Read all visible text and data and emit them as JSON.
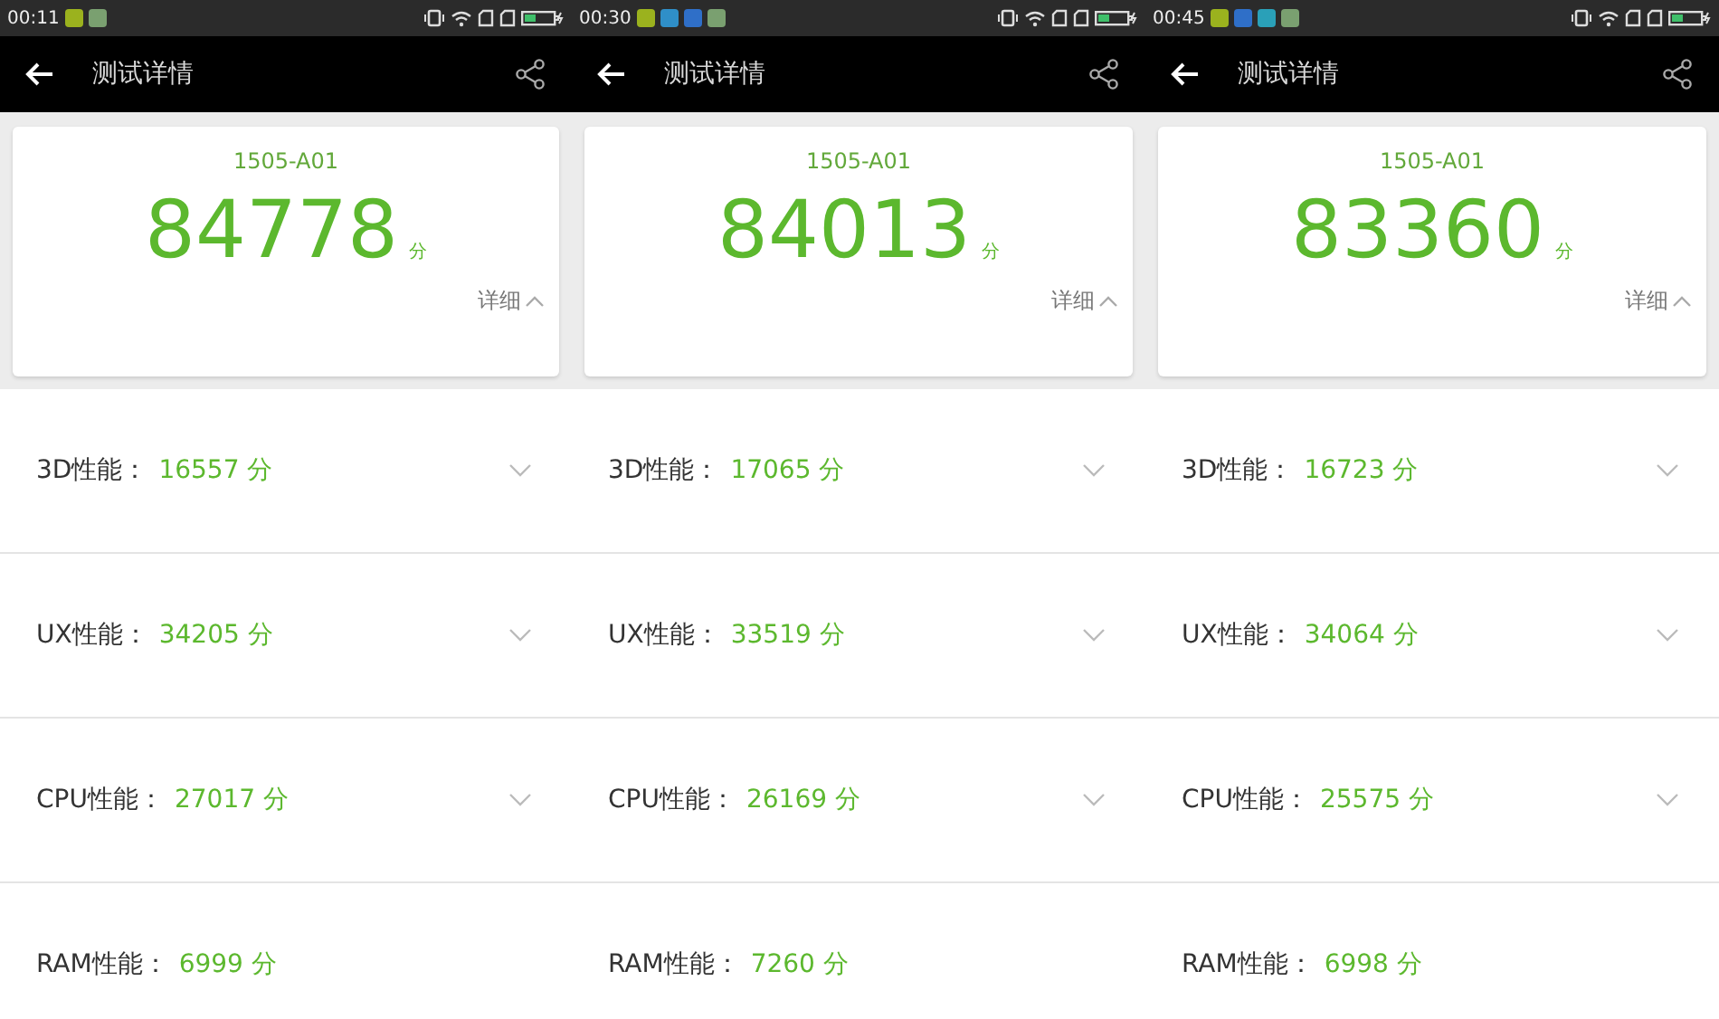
{
  "panels": [
    {
      "status_bar": {
        "time": "00:11",
        "notifications": [
          {
            "color": "#9bb21e"
          },
          {
            "color": "#7aa070"
          }
        ]
      },
      "header": {
        "title": "测试详情"
      },
      "card": {
        "device": "1505-A01",
        "score": "84778",
        "unit": "分",
        "details": "详细"
      },
      "rows": [
        {
          "label": "3D性能：",
          "value": "16557 分",
          "expandable": true
        },
        {
          "label": "UX性能：",
          "value": "34205 分",
          "expandable": true
        },
        {
          "label": "CPU性能：",
          "value": "27017 分",
          "expandable": true
        },
        {
          "label": "RAM性能：",
          "value": "6999 分",
          "expandable": false
        }
      ]
    },
    {
      "status_bar": {
        "time": "00:30",
        "notifications": [
          {
            "color": "#9bb21e"
          },
          {
            "color": "#2f8fc8"
          },
          {
            "color": "#2f6fc8"
          },
          {
            "color": "#7aa070"
          }
        ]
      },
      "header": {
        "title": "测试详情"
      },
      "card": {
        "device": "1505-A01",
        "score": "84013",
        "unit": "分",
        "details": "详细"
      },
      "rows": [
        {
          "label": "3D性能：",
          "value": "17065 分",
          "expandable": true
        },
        {
          "label": "UX性能：",
          "value": "33519 分",
          "expandable": true
        },
        {
          "label": "CPU性能：",
          "value": "26169 分",
          "expandable": true
        },
        {
          "label": "RAM性能：",
          "value": "7260 分",
          "expandable": false
        }
      ]
    },
    {
      "status_bar": {
        "time": "00:45",
        "notifications": [
          {
            "color": "#9bb21e"
          },
          {
            "color": "#2f6fc8"
          },
          {
            "color": "#2aa0b8"
          },
          {
            "color": "#7aa070"
          }
        ]
      },
      "header": {
        "title": "测试详情"
      },
      "card": {
        "device": "1505-A01",
        "score": "83360",
        "unit": "分",
        "details": "详细"
      },
      "rows": [
        {
          "label": "3D性能：",
          "value": "16723 分",
          "expandable": true
        },
        {
          "label": "UX性能：",
          "value": "34064 分",
          "expandable": true
        },
        {
          "label": "CPU性能：",
          "value": "25575 分",
          "expandable": true
        },
        {
          "label": "RAM性能：",
          "value": "6998 分",
          "expandable": false
        }
      ]
    }
  ]
}
